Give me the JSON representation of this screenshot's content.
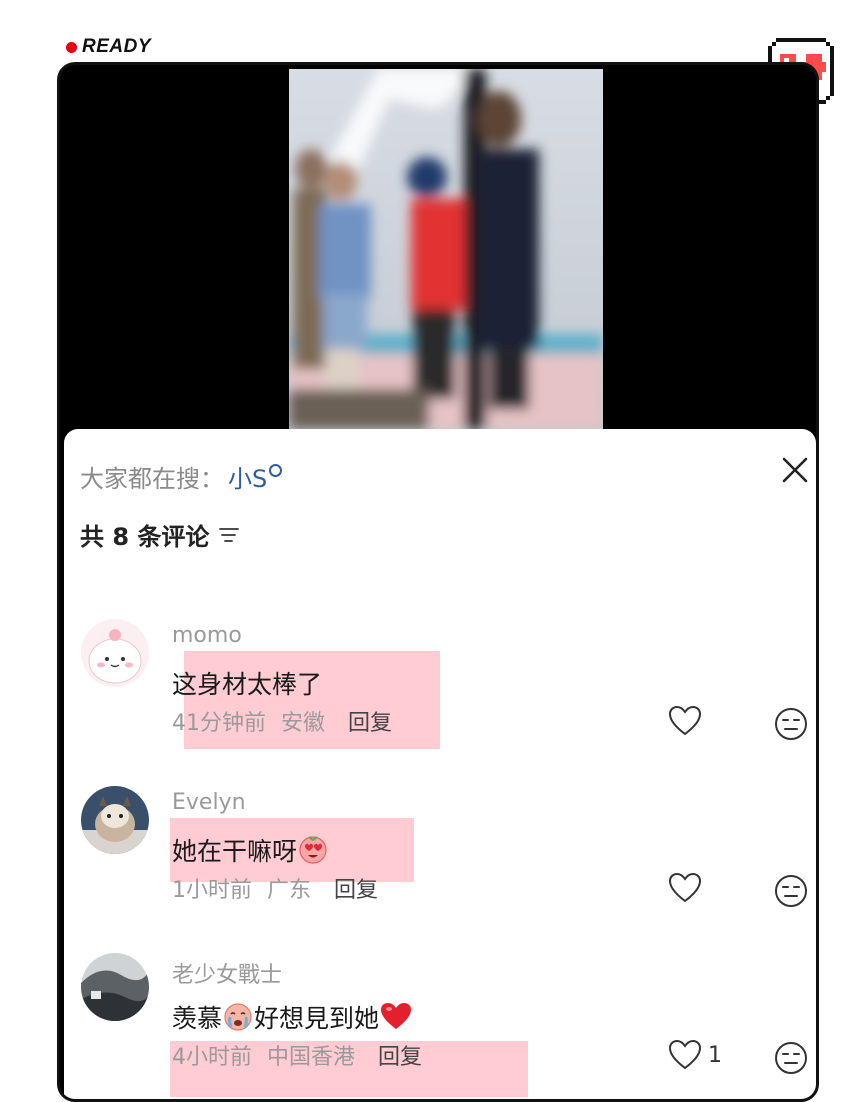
{
  "status": {
    "label": "READY",
    "dot_color": "#e60012"
  },
  "badge": {
    "icon": "pixel-heart-speech-bubble-icon",
    "color": "#ff4b4b"
  },
  "search": {
    "prefix": "大家都在搜：",
    "term": "小S"
  },
  "comments_header": {
    "count_text": "共 8 条评论"
  },
  "comments": [
    {
      "author": "momo",
      "text": "这身材太棒了",
      "time": "41分钟前",
      "location": "安徽",
      "reply": "回复",
      "likes": ""
    },
    {
      "author": "Evelyn",
      "text": "她在干嘛呀",
      "emoji_after": "heart-eyes-emoji",
      "time": "1小时前",
      "location": "广东",
      "reply": "回复",
      "likes": ""
    },
    {
      "author": "老少女戰士",
      "text_part1": "羡慕",
      "emoji_mid": "crying-face-emoji",
      "text_part2": "好想見到她",
      "emoji_after": "red-heart-emoji",
      "time": "4小时前",
      "location": "中国香港",
      "reply": "回复",
      "likes": "1"
    }
  ],
  "colors": {
    "highlight": "#ff788c",
    "search_term": "#2d5f9a",
    "meta": "#9a9a9a"
  }
}
